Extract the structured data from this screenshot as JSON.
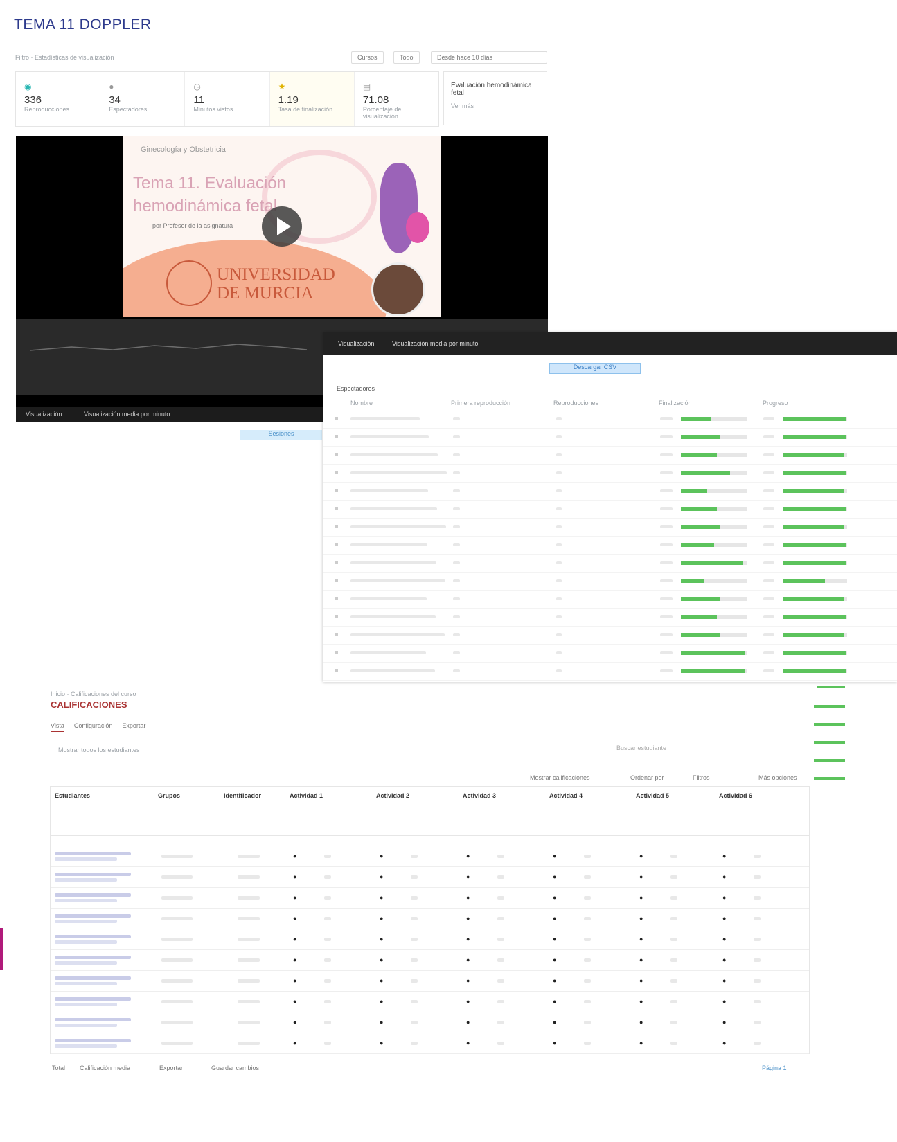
{
  "page": {
    "title": "TEMA 11 DOPPLER"
  },
  "filters": {
    "breadcrumb": "Filtro · Estadísticas de visualización",
    "options": [
      "Cursos",
      "Todo",
      "Desde hace 10 días"
    ]
  },
  "stats": [
    {
      "icon": "eye-icon",
      "value": "336",
      "label": "Reproducciones",
      "color": "#2bb7b3"
    },
    {
      "icon": "user-icon",
      "value": "34",
      "label": "Espectadores",
      "color": "#888888"
    },
    {
      "icon": "clock-icon",
      "value": "11",
      "label": "Minutos vistos",
      "color": "#888888"
    },
    {
      "icon": "star-icon",
      "value": "1.19",
      "label": "Tasa de finalización",
      "color": "#e0b300"
    },
    {
      "icon": "chart-icon",
      "value": "71.08",
      "label": "Porcentaje de visualización",
      "color": "#888888"
    }
  ],
  "side_card": {
    "title": "Evaluación hemodinámica fetal",
    "link": "Ver más"
  },
  "video": {
    "header": "Ginecología y Obstetricia",
    "title_line1": "Tema 11. Evaluación",
    "title_line2": "hemodinámica fetal",
    "author": "por Profesor de la asignatura",
    "logo_line1": "UNIVERSIDAD",
    "logo_line2": "DE MURCIA",
    "tabs": [
      "Visualización",
      "Visualización media por minuto"
    ],
    "badge": "Sesiones"
  },
  "viewers_panel": {
    "tabs": [
      "Visualización",
      "Visualización media por minuto"
    ],
    "highlight": "Descargar CSV",
    "section": "Espectadores",
    "columns": [
      "Nombre",
      "Primera reproducción",
      "Reproducciones",
      "Finalización",
      "Progreso"
    ],
    "rows": [
      {
        "progress": 0.45,
        "finish": 0.98
      },
      {
        "progress": 0.6,
        "finish": 0.98
      },
      {
        "progress": 0.55,
        "finish": 0.96
      },
      {
        "progress": 0.75,
        "finish": 0.98
      },
      {
        "progress": 0.4,
        "finish": 0.96
      },
      {
        "progress": 0.55,
        "finish": 0.98
      },
      {
        "progress": 0.6,
        "finish": 0.96
      },
      {
        "progress": 0.5,
        "finish": 0.98
      },
      {
        "progress": 0.95,
        "finish": 0.98
      },
      {
        "progress": 0.35,
        "finish": 0.65
      },
      {
        "progress": 0.6,
        "finish": 0.96
      },
      {
        "progress": 0.55,
        "finish": 0.98
      },
      {
        "progress": 0.6,
        "finish": 0.96
      },
      {
        "progress": 0.98,
        "finish": 0.98
      },
      {
        "progress": 0.98,
        "finish": 0.98
      }
    ]
  },
  "grades": {
    "breadcrumb": "Inicio · Calificaciones del curso",
    "title": "CALIFICACIONES",
    "tabs": [
      "Vista",
      "Configuración",
      "Exportar"
    ],
    "filter": "Mostrar todos los estudiantes",
    "search_placeholder": "Buscar estudiante",
    "toolbar": [
      "Mostrar calificaciones",
      "Ordenar por",
      "Filtros",
      "Más opciones"
    ],
    "columns": [
      "Estudiantes",
      "Grupos",
      "Identificador",
      "Actividad 1",
      "Actividad 2",
      "Actividad 3",
      "Actividad 4",
      "Actividad 5",
      "Actividad 6"
    ],
    "row_count": 10,
    "footer": [
      "Total",
      "Calificación media",
      "Exportar",
      "Guardar cambios"
    ],
    "pagination": "Página 1"
  }
}
